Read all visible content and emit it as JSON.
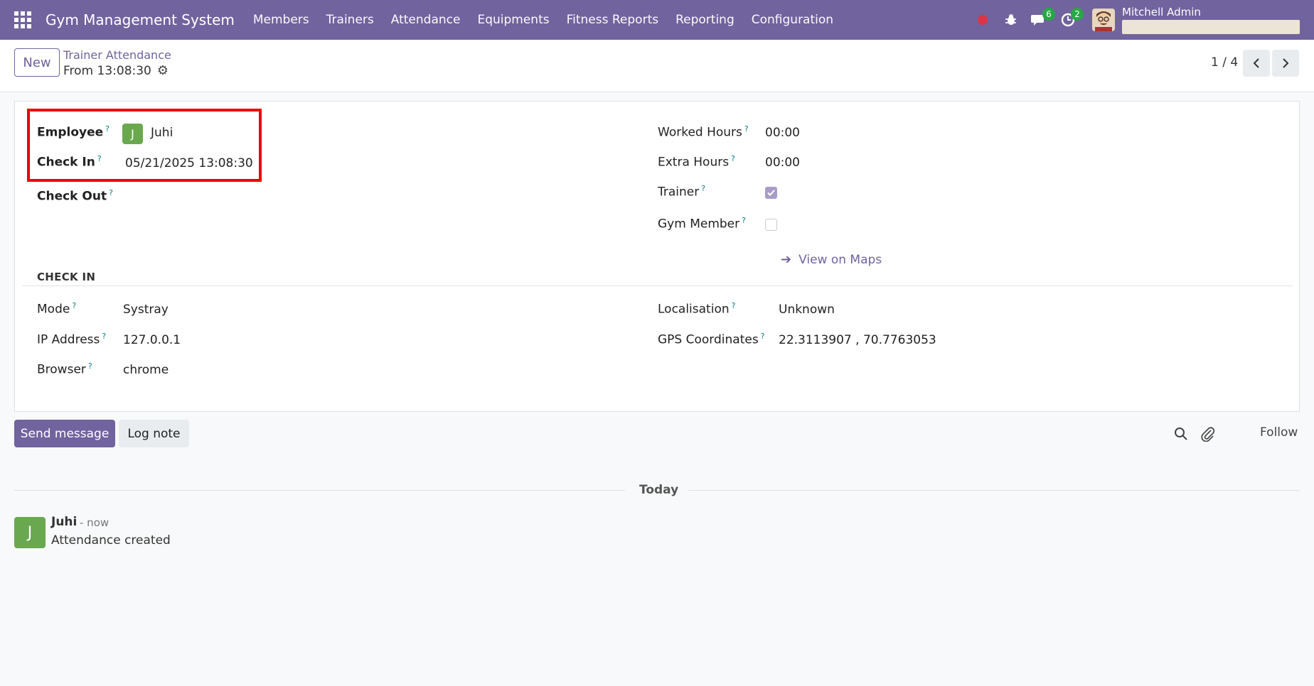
{
  "navbar": {
    "brand": "Gym Management System",
    "menu": [
      "Members",
      "Trainers",
      "Attendance",
      "Equipments",
      "Fitness Reports",
      "Reporting",
      "Configuration"
    ],
    "messages_count": "6",
    "activities_count": "2",
    "user_name": "Mitchell Admin",
    "color": "#71639e"
  },
  "control": {
    "new_label": "New",
    "breadcrumb": "Trainer Attendance",
    "record_title": "From 13:08:30",
    "pager": "1 / 4"
  },
  "form": {
    "employee_label": "Employee",
    "employee_value": "Juhi",
    "employee_initial": "J",
    "check_in_label": "Check In",
    "check_in_value": "05/21/2025 13:08:30",
    "check_out_label": "Check Out",
    "worked_hours_label": "Worked Hours",
    "worked_hours_value": "00:00",
    "extra_hours_label": "Extra Hours",
    "extra_hours_value": "00:00",
    "trainer_label": "Trainer",
    "trainer_checked": true,
    "gym_member_label": "Gym Member",
    "gym_member_checked": false,
    "section_title": "CHECK IN",
    "mode_label": "Mode",
    "mode_value": "Systray",
    "ip_label": "IP Address",
    "ip_value": "127.0.0.1",
    "browser_label": "Browser",
    "browser_value": "chrome",
    "localisation_label": "Localisation",
    "localisation_value": "Unknown",
    "gps_label": "GPS Coordinates",
    "gps_value": "22.3113907 , 70.7763053",
    "maps_link": "View on Maps",
    "help_mark": "?"
  },
  "chatter": {
    "send_label": "Send message",
    "log_label": "Log note",
    "follow_label": "Follow",
    "today_label": "Today",
    "message": {
      "author": "Juhi",
      "initial": "J",
      "time": "- now",
      "body": "Attendance created"
    }
  }
}
